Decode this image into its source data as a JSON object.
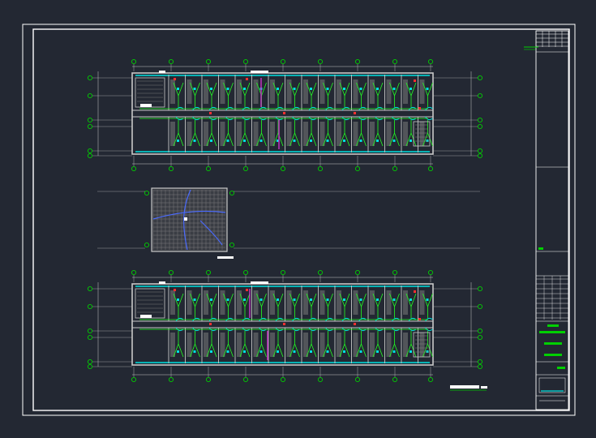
{
  "drawing": {
    "sheet_type": "cad-floor-plan-sheet",
    "background_color": "#232833",
    "colors": {
      "frame": "#ffffff",
      "wall": "#c8c8c8",
      "grid_bubble": "#00d000",
      "wiring": "#22ff22",
      "fixture": "#00e0e0",
      "accent": "#ff3030",
      "magenta": "#cc33cc",
      "blue_line": "#4a6aff",
      "hatch": "#7a7a7a"
    },
    "plans": [
      {
        "name": "upper-floor-plan",
        "bays": 8
      },
      {
        "name": "lower-floor-plan",
        "bays": 8
      }
    ],
    "detail": {
      "name": "enlarged-room-detail"
    },
    "title_block": {
      "name": "title-block"
    }
  }
}
